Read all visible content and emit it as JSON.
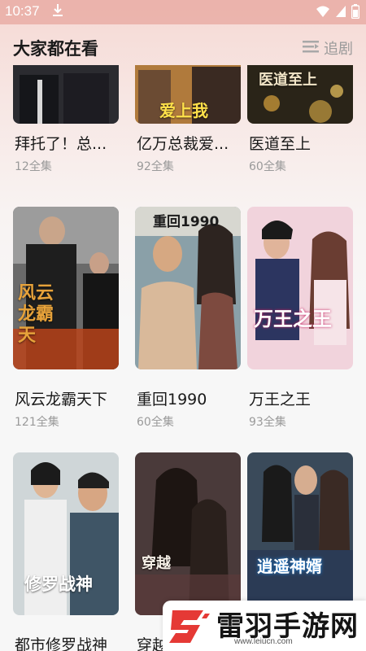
{
  "status": {
    "time": "10:37"
  },
  "header": {
    "title": "大家都在看",
    "follow_label": "追剧"
  },
  "dramas": [
    {
      "title": "拜托了！总...",
      "episodes": "12全集",
      "poster_text": ""
    },
    {
      "title": "亿万总裁爱...",
      "episodes": "92全集",
      "poster_text": "爱上我"
    },
    {
      "title": "医道至上",
      "episodes": "60全集",
      "poster_text": "医道至上"
    },
    {
      "title": "风云龙霸天下",
      "episodes": "121全集",
      "poster_text": "风云龙霸天"
    },
    {
      "title": "重回1990",
      "episodes": "60全集",
      "poster_text": "重回1990"
    },
    {
      "title": "万王之王",
      "episodes": "93全集",
      "poster_text": "万王之王"
    },
    {
      "title": "都市修罗战神",
      "episodes": "",
      "poster_text": "修罗战神"
    },
    {
      "title": "穿越",
      "episodes": "",
      "poster_text": "穿越"
    },
    {
      "title": "",
      "episodes": "",
      "poster_text": "逍遥神婿"
    }
  ],
  "watermark": {
    "name": "雷羽手游网",
    "url": "www.leiucn.com"
  },
  "colors": {
    "accent": "#e53935",
    "bg_top": "#f6d9d4"
  }
}
